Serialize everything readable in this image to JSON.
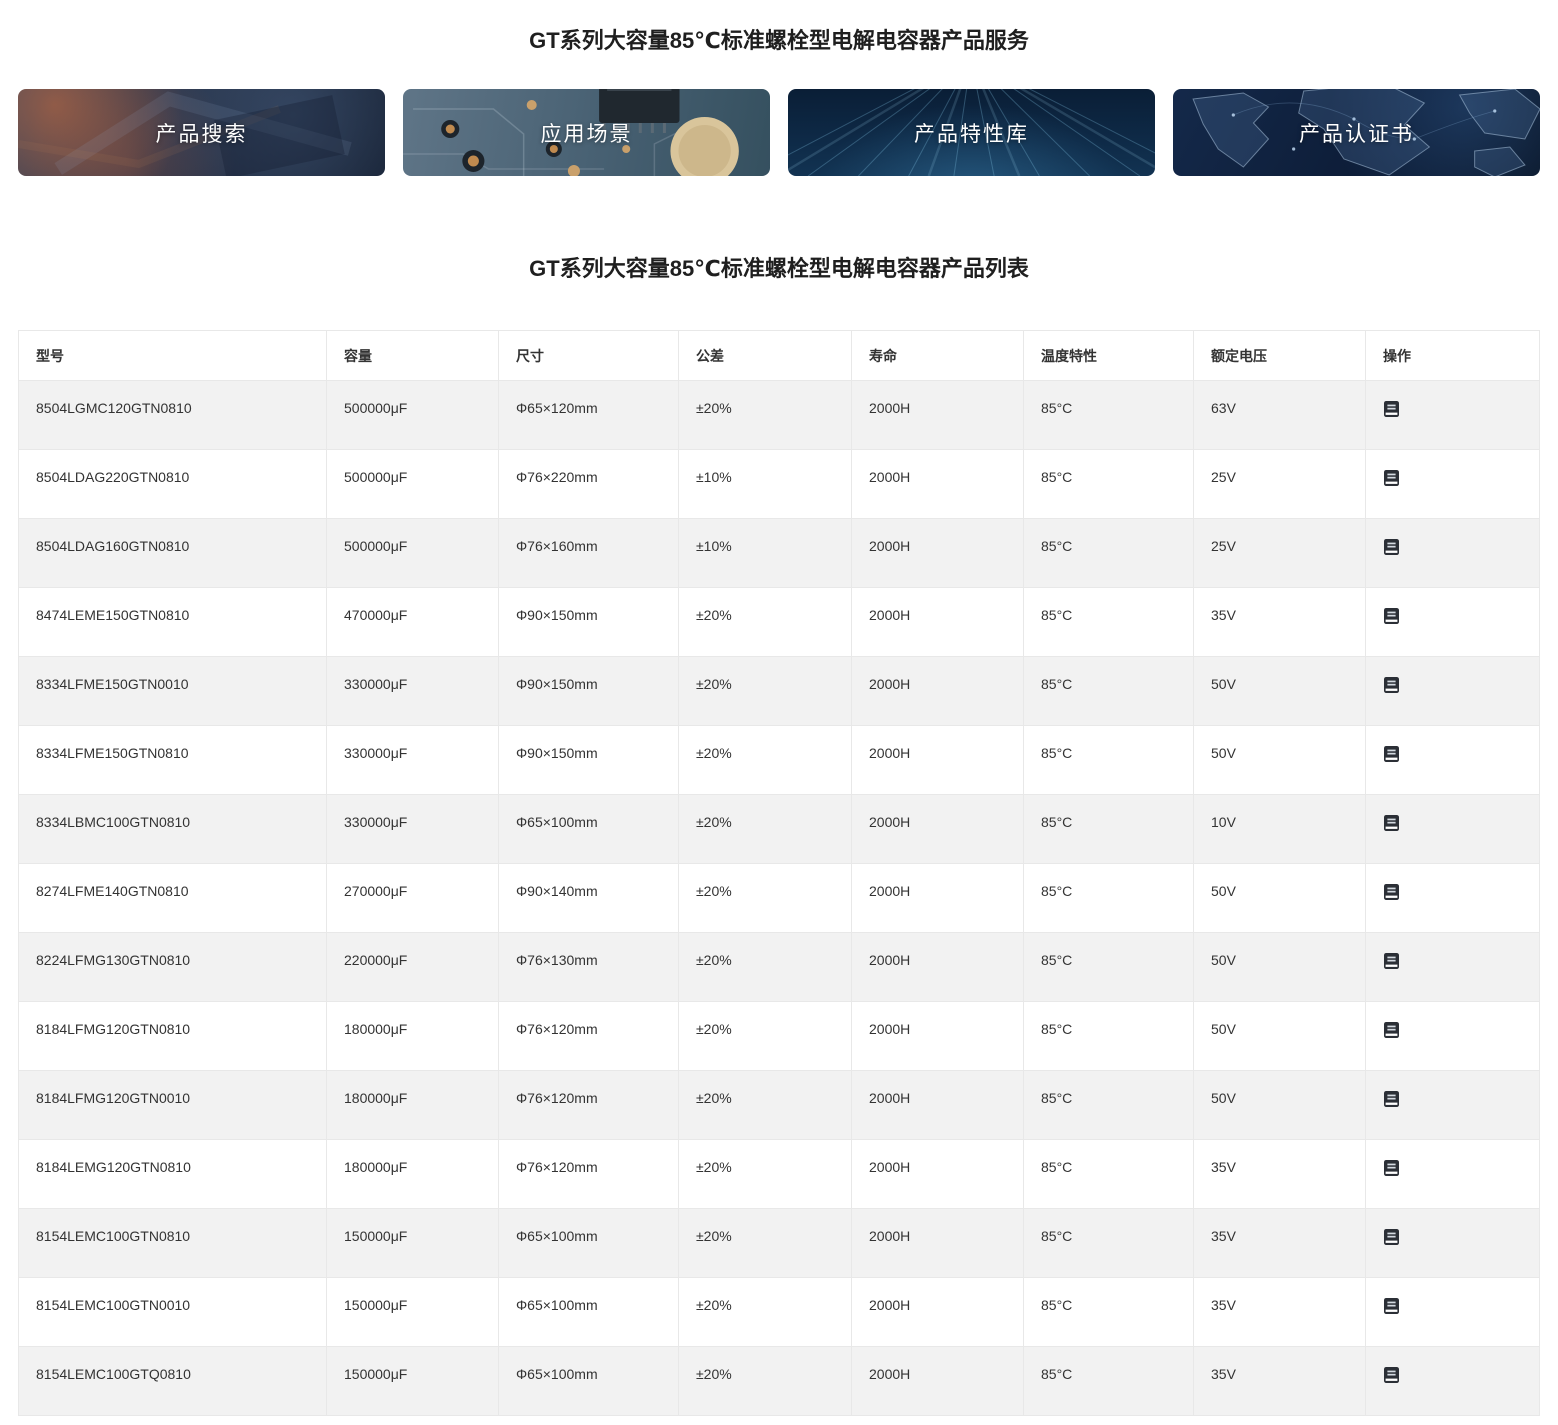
{
  "page": {
    "service_title": "GT系列大容量85℃标准螺栓型电解电容器产品服务",
    "list_title": "GT系列大容量85℃标准螺栓型电解电容器产品列表"
  },
  "nav_cards": [
    {
      "label": "产品搜索"
    },
    {
      "label": "应用场景"
    },
    {
      "label": "产品特性库"
    },
    {
      "label": "产品认证书"
    }
  ],
  "table": {
    "headers": [
      "型号",
      "容量",
      "尺寸",
      "公差",
      "寿命",
      "温度特性",
      "额定电压",
      "操作"
    ],
    "action_icon": "book-icon",
    "rows": [
      {
        "model": "8504LGMC120GTN0810",
        "capacity": "500000μF",
        "size": "Φ65×120mm",
        "tolerance": "±20%",
        "life": "2000H",
        "temp": "85°C",
        "voltage": "63V"
      },
      {
        "model": "8504LDAG220GTN0810",
        "capacity": "500000μF",
        "size": "Φ76×220mm",
        "tolerance": "±10%",
        "life": "2000H",
        "temp": "85°C",
        "voltage": "25V"
      },
      {
        "model": "8504LDAG160GTN0810",
        "capacity": "500000μF",
        "size": "Φ76×160mm",
        "tolerance": "±10%",
        "life": "2000H",
        "temp": "85°C",
        "voltage": "25V"
      },
      {
        "model": "8474LEME150GTN0810",
        "capacity": "470000μF",
        "size": "Φ90×150mm",
        "tolerance": "±20%",
        "life": "2000H",
        "temp": "85°C",
        "voltage": "35V"
      },
      {
        "model": "8334LFME150GTN0010",
        "capacity": "330000μF",
        "size": "Φ90×150mm",
        "tolerance": "±20%",
        "life": "2000H",
        "temp": "85°C",
        "voltage": "50V"
      },
      {
        "model": "8334LFME150GTN0810",
        "capacity": "330000μF",
        "size": "Φ90×150mm",
        "tolerance": "±20%",
        "life": "2000H",
        "temp": "85°C",
        "voltage": "50V"
      },
      {
        "model": "8334LBMC100GTN0810",
        "capacity": "330000μF",
        "size": "Φ65×100mm",
        "tolerance": "±20%",
        "life": "2000H",
        "temp": "85°C",
        "voltage": "10V"
      },
      {
        "model": "8274LFME140GTN0810",
        "capacity": "270000μF",
        "size": "Φ90×140mm",
        "tolerance": "±20%",
        "life": "2000H",
        "temp": "85°C",
        "voltage": "50V"
      },
      {
        "model": "8224LFMG130GTN0810",
        "capacity": "220000μF",
        "size": "Φ76×130mm",
        "tolerance": "±20%",
        "life": "2000H",
        "temp": "85°C",
        "voltage": "50V"
      },
      {
        "model": "8184LFMG120GTN0810",
        "capacity": "180000μF",
        "size": "Φ76×120mm",
        "tolerance": "±20%",
        "life": "2000H",
        "temp": "85°C",
        "voltage": "50V"
      },
      {
        "model": "8184LFMG120GTN0010",
        "capacity": "180000μF",
        "size": "Φ76×120mm",
        "tolerance": "±20%",
        "life": "2000H",
        "temp": "85°C",
        "voltage": "50V"
      },
      {
        "model": "8184LEMG120GTN0810",
        "capacity": "180000μF",
        "size": "Φ76×120mm",
        "tolerance": "±20%",
        "life": "2000H",
        "temp": "85°C",
        "voltage": "35V"
      },
      {
        "model": "8154LEMC100GTN0810",
        "capacity": "150000μF",
        "size": "Φ65×100mm",
        "tolerance": "±20%",
        "life": "2000H",
        "temp": "85°C",
        "voltage": "35V"
      },
      {
        "model": "8154LEMC100GTN0010",
        "capacity": "150000μF",
        "size": "Φ65×100mm",
        "tolerance": "±20%",
        "life": "2000H",
        "temp": "85°C",
        "voltage": "35V"
      },
      {
        "model": "8154LEMC100GTQ0810",
        "capacity": "150000μF",
        "size": "Φ65×100mm",
        "tolerance": "±20%",
        "life": "2000H",
        "temp": "85°C",
        "voltage": "35V"
      }
    ]
  },
  "colors": {
    "stripe_row": "#f2f2f2",
    "table_border": "#e8e8e8",
    "text": "#333333",
    "card_navy": "#0d2742",
    "card_label": "#ffffff"
  }
}
